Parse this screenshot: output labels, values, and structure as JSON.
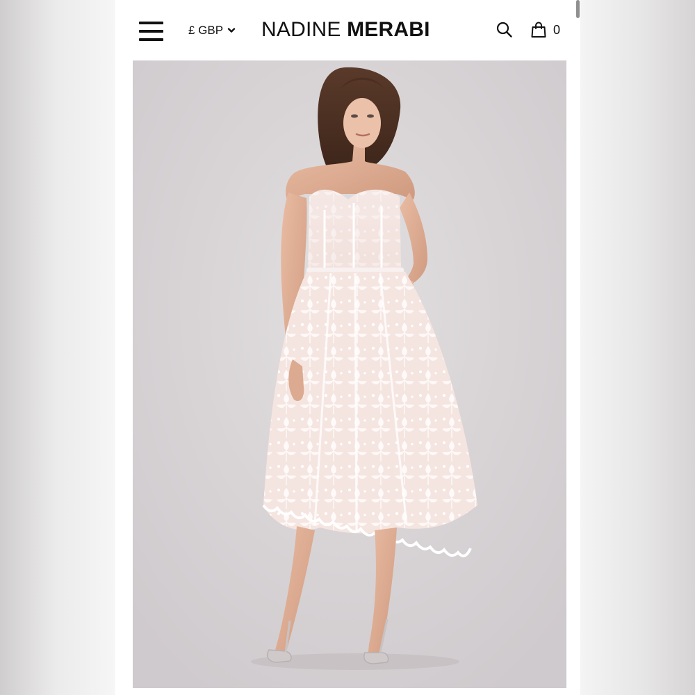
{
  "header": {
    "menu_icon": "hamburger-menu-icon",
    "currency_label": "£ GBP",
    "currency_icon": "chevron-down-icon",
    "brand_light": "NADINE",
    "brand_bold": "MERABI",
    "search_icon": "search-icon",
    "bag_icon": "shopping-bag-icon",
    "bag_count": "0"
  },
  "product": {
    "image": "model-wearing-strapless-white-lace-midi-dress-photo"
  },
  "colors": {
    "text": "#111111",
    "background": "#ffffff",
    "photo_backdrop": "#d8d4d6"
  }
}
